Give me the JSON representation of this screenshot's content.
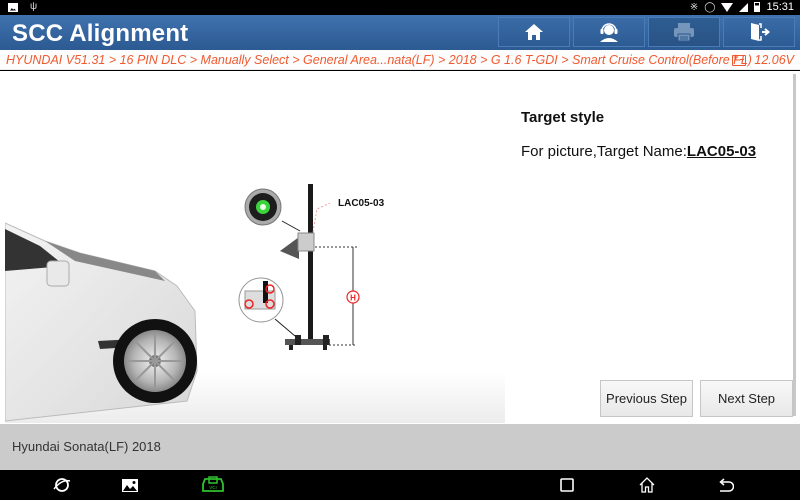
{
  "status_bar": {
    "time": "15:31",
    "left_icons": [
      "image-notification-icon",
      "usb-icon"
    ],
    "right_icons": [
      "bluetooth-icon",
      "vibrate-icon",
      "wifi-icon",
      "signal-icon",
      "battery-icon"
    ]
  },
  "header": {
    "title": "SCC Alignment",
    "buttons": [
      {
        "name": "home",
        "icon": "home-icon",
        "enabled": true
      },
      {
        "name": "support",
        "icon": "headset-icon",
        "enabled": true
      },
      {
        "name": "print",
        "icon": "printer-icon",
        "enabled": false
      },
      {
        "name": "exit",
        "icon": "exit-door-icon",
        "enabled": true
      }
    ]
  },
  "breadcrumb": {
    "path": "HYUNDAI V51.31 > 16 PIN DLC > Manually Select > General Area...nata(LF) > 2018 > G 1.6 T-GDI > Smart Cruise Control(Before FL)",
    "voltage": "12.06V",
    "accent_color": "#ef5a30"
  },
  "content": {
    "figure_label": "LAC05-03",
    "height_marker": "H",
    "target_style_heading": "Target style",
    "target_name_prefix": "For picture,Target Name:",
    "target_name_value": "LAC05-03",
    "prev_button": "Previous Step",
    "next_button": "Next Step"
  },
  "footer": {
    "vehicle": "Hyundai Sonata(LF) 2018"
  },
  "nav_bar": {
    "icons": [
      "browser-icon",
      "gallery-icon",
      "vci-icon",
      "recents-icon",
      "home-nav-icon",
      "back-icon"
    ],
    "vci_color": "#2fc12f"
  }
}
